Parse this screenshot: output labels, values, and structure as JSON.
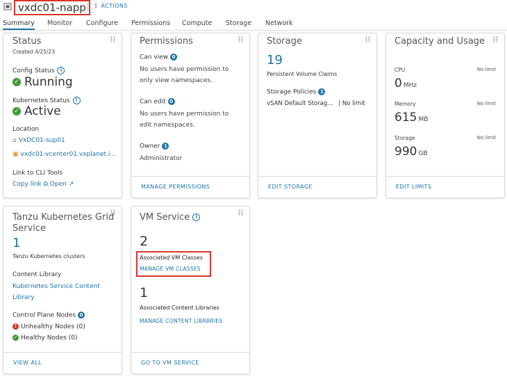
{
  "header": {
    "title": "vxdc01-napp",
    "actions_label": "ACTIONS"
  },
  "tabs": [
    {
      "label": "Summary",
      "active": true
    },
    {
      "label": "Monitor"
    },
    {
      "label": "Configure"
    },
    {
      "label": "Permissions"
    },
    {
      "label": "Compute"
    },
    {
      "label": "Storage"
    },
    {
      "label": "Network"
    }
  ],
  "status": {
    "title": "Status",
    "created": "Created 4/25/23",
    "config_label": "Config Status",
    "config_value": "Running",
    "k8s_label": "Kubernetes Status",
    "k8s_value": "Active",
    "location_label": "Location",
    "location_dc": "VxDC01-sup01",
    "location_vc": "vxdc01-vcenter01.vxplanet.i...",
    "cli_label": "Link to CLI Tools",
    "copy_link": "Copy link",
    "open": "Open"
  },
  "permissions": {
    "title": "Permissions",
    "can_view_label": "Can view",
    "can_view_count": "0",
    "can_view_text1": "No users have permission to",
    "can_view_text2": "only view namespaces.",
    "can_edit_label": "Can edit",
    "can_edit_count": "0",
    "can_edit_text1": "No users have permission to",
    "can_edit_text2": "edit namespaces.",
    "owner_label": "Owner",
    "owner_count": "1",
    "owner_value": "Administrator",
    "footer": "MANAGE PERMISSIONS"
  },
  "storage": {
    "title": "Storage",
    "pvc_count": "19",
    "pvc_label": "Persistent Volume Claims",
    "policies_label": "Storage Policies",
    "policies_count": "1",
    "policy_name": "vSAN Default Storag...",
    "policy_limit": "| No limit",
    "footer": "EDIT STORAGE"
  },
  "capacity": {
    "title": "Capacity and Usage",
    "cpu_label": "CPU",
    "cpu_limit": "No limit",
    "cpu_value": "0",
    "cpu_unit": "MHz",
    "mem_label": "Memory",
    "mem_limit": "No limit",
    "mem_value": "615",
    "mem_unit": "MB",
    "sto_label": "Storage",
    "sto_limit": "No limit",
    "sto_value": "990",
    "sto_unit": "GB",
    "footer": "EDIT LIMITS"
  },
  "tkg": {
    "title_line1": "Tanzu Kubernetes Grid",
    "title_line2": "Service",
    "clusters_count": "1",
    "clusters_label": "Tanzu Kubernetes clusters",
    "content_lib_label": "Content Library",
    "content_lib_link1": "Kubernetes Service Content",
    "content_lib_link2": "Library",
    "cp_nodes_label": "Control Plane Nodes",
    "cp_nodes_count": "0",
    "unhealthy": "Unhealthy Nodes (0)",
    "healthy": "Healthy Nodes (0)",
    "footer": "VIEW ALL"
  },
  "vm_service": {
    "title": "VM Service",
    "vm_classes_count": "2",
    "vm_classes_label": "Associated VM Classes",
    "manage_classes": "MANAGE VM CLASSES",
    "content_libs_count": "1",
    "content_libs_label": "Associated Content Libraries",
    "manage_libs": "MANAGE CONTENT LIBRARIES",
    "footer": "GO TO VM SERVICE"
  },
  "colors": {
    "accent": "#1a73a8",
    "ok": "#3d9b35",
    "error": "#d9362c",
    "highlight": "#d9362c"
  }
}
